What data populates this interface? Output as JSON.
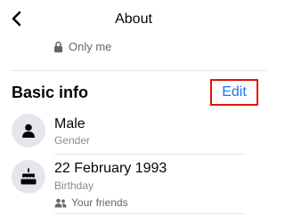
{
  "header": {
    "title": "About",
    "back_icon": "chevron-left-icon"
  },
  "previous_item": {
    "privacy_label": "Only me",
    "privacy_icon": "lock-icon"
  },
  "basic_info": {
    "section_title": "Basic info",
    "edit_label": "Edit",
    "highlight_color": "#e3120b",
    "link_color": "#1877f2",
    "items": [
      {
        "icon": "person-icon",
        "value": "Male",
        "label": "Gender"
      },
      {
        "icon": "birthday-cake-icon",
        "value": "22 February 1993",
        "label": "Birthday",
        "audience": "Your friends",
        "audience_icon": "friends-icon"
      }
    ]
  }
}
